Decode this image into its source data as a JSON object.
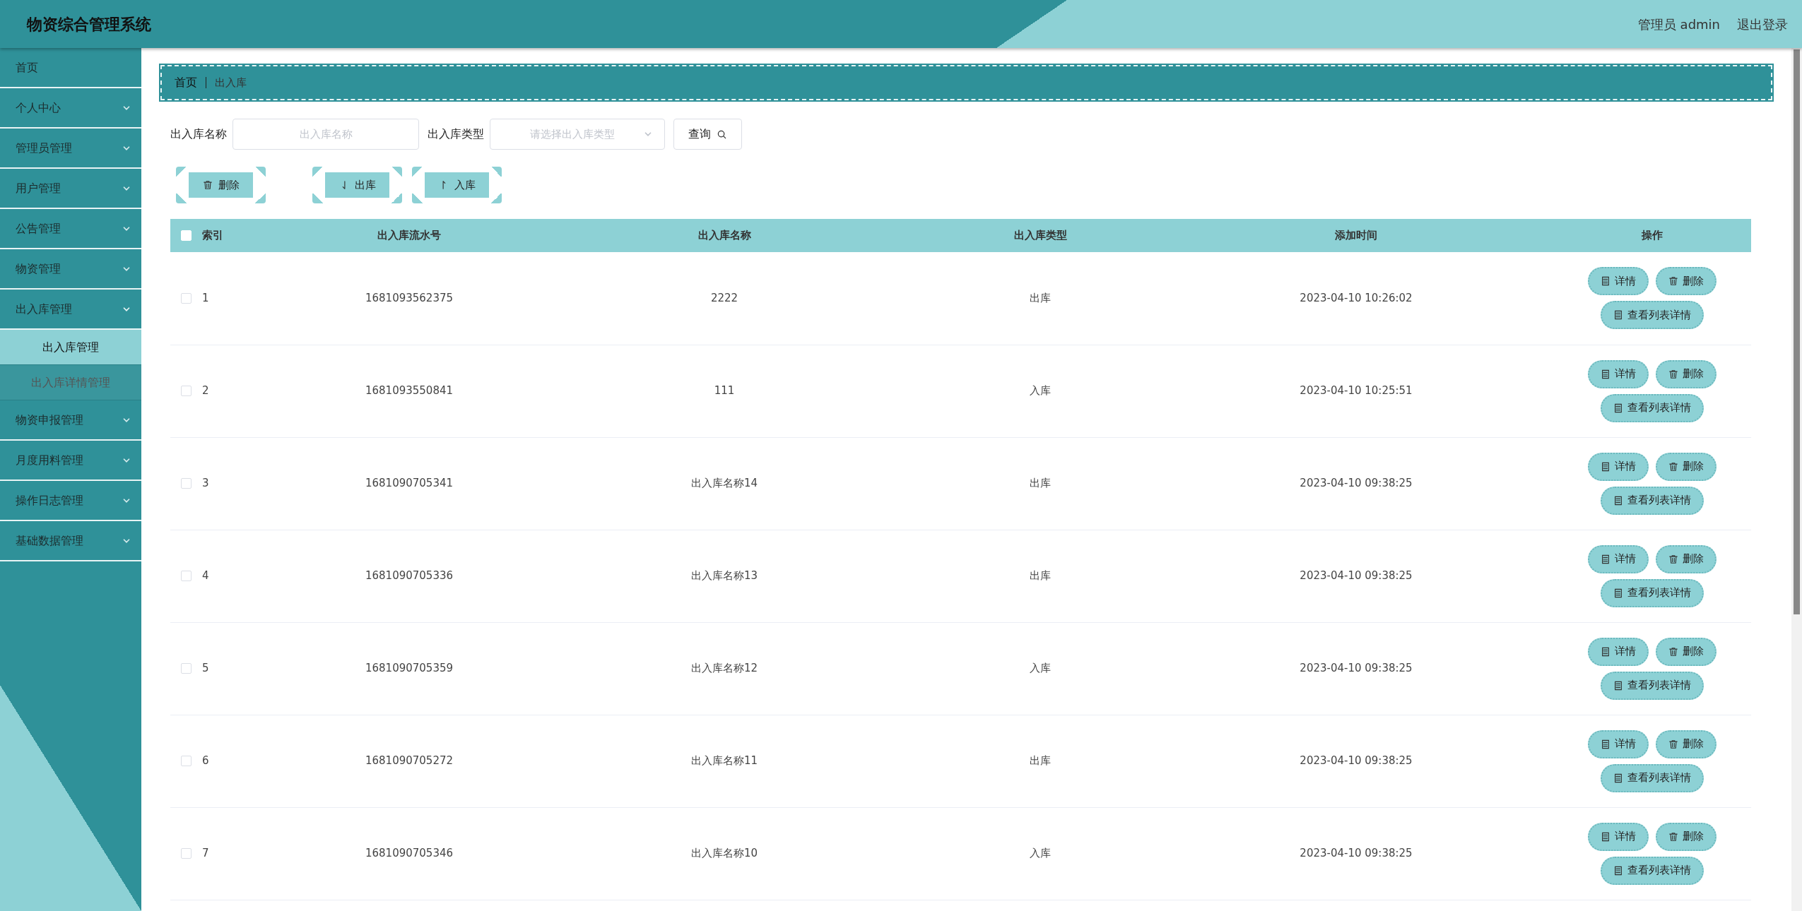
{
  "app": {
    "title": "物资综合管理系统",
    "user": "管理员 admin",
    "logout": "退出登录"
  },
  "sidebar": {
    "items": [
      {
        "label": "首页",
        "kind": "link"
      },
      {
        "label": "个人中心",
        "kind": "menu",
        "expanded": false
      },
      {
        "label": "管理员管理",
        "kind": "menu",
        "expanded": false
      },
      {
        "label": "用户管理",
        "kind": "menu",
        "expanded": false
      },
      {
        "label": "公告管理",
        "kind": "menu",
        "expanded": false
      },
      {
        "label": "物资管理",
        "kind": "menu",
        "expanded": false
      },
      {
        "label": "出入库管理",
        "kind": "menu",
        "expanded": true,
        "children": [
          {
            "label": "出入库管理",
            "selected": true
          },
          {
            "label": "出入库详情管理",
            "selected": false
          }
        ]
      },
      {
        "label": "物资申报管理",
        "kind": "menu",
        "expanded": false
      },
      {
        "label": "月度用料管理",
        "kind": "menu",
        "expanded": false
      },
      {
        "label": "操作日志管理",
        "kind": "menu",
        "expanded": false
      },
      {
        "label": "基础数据管理",
        "kind": "menu",
        "expanded": false
      }
    ]
  },
  "breadcrumb": [
    "首页",
    "出入库"
  ],
  "search": {
    "fields": [
      {
        "label": "出入库名称",
        "placeholder": "出入库名称",
        "kind": "input"
      },
      {
        "label": "出入库类型",
        "placeholder": "请选择出入库类型",
        "kind": "select"
      }
    ],
    "button": "查询"
  },
  "toolbar": [
    {
      "label": "删除",
      "kind": "delete"
    },
    {
      "label": "出库",
      "kind": "out"
    },
    {
      "label": "入库",
      "kind": "in"
    }
  ],
  "table": {
    "select_all": {
      "checked": false
    },
    "columns": [
      "索引",
      "出入库流水号",
      "出入库名称",
      "出入库类型",
      "添加时间",
      "操作"
    ],
    "rows": [
      {
        "checked": false,
        "cells": [
          "1",
          "1681093562375",
          "2222",
          "出库",
          "2023-04-10 10:26:02"
        ],
        "actions": [
          {
            "label": "详情",
            "kind": "doc"
          },
          {
            "label": "删除",
            "kind": "delete"
          },
          {
            "label": "查看列表详情",
            "kind": "doc"
          }
        ]
      },
      {
        "checked": false,
        "cells": [
          "2",
          "1681093550841",
          "111",
          "入库",
          "2023-04-10 10:25:51"
        ],
        "actions": [
          {
            "label": "详情",
            "kind": "doc"
          },
          {
            "label": "删除",
            "kind": "delete"
          },
          {
            "label": "查看列表详情",
            "kind": "doc"
          }
        ]
      },
      {
        "checked": false,
        "cells": [
          "3",
          "1681090705341",
          "出入库名称14",
          "出库",
          "2023-04-10 09:38:25"
        ],
        "actions": [
          {
            "label": "详情",
            "kind": "doc"
          },
          {
            "label": "删除",
            "kind": "delete"
          },
          {
            "label": "查看列表详情",
            "kind": "doc"
          }
        ]
      },
      {
        "checked": false,
        "cells": [
          "4",
          "1681090705336",
          "出入库名称13",
          "出库",
          "2023-04-10 09:38:25"
        ],
        "actions": [
          {
            "label": "详情",
            "kind": "doc"
          },
          {
            "label": "删除",
            "kind": "delete"
          },
          {
            "label": "查看列表详情",
            "kind": "doc"
          }
        ]
      },
      {
        "checked": false,
        "cells": [
          "5",
          "1681090705359",
          "出入库名称12",
          "入库",
          "2023-04-10 09:38:25"
        ],
        "actions": [
          {
            "label": "详情",
            "kind": "doc"
          },
          {
            "label": "删除",
            "kind": "delete"
          },
          {
            "label": "查看列表详情",
            "kind": "doc"
          }
        ]
      },
      {
        "checked": false,
        "cells": [
          "6",
          "1681090705272",
          "出入库名称11",
          "出库",
          "2023-04-10 09:38:25"
        ],
        "actions": [
          {
            "label": "详情",
            "kind": "doc"
          },
          {
            "label": "删除",
            "kind": "delete"
          },
          {
            "label": "查看列表详情",
            "kind": "doc"
          }
        ]
      },
      {
        "checked": false,
        "cells": [
          "7",
          "1681090705346",
          "出入库名称10",
          "入库",
          "2023-04-10 09:38:25"
        ],
        "actions": [
          {
            "label": "详情",
            "kind": "doc"
          },
          {
            "label": "删除",
            "kind": "delete"
          },
          {
            "label": "查看列表详情",
            "kind": "doc"
          }
        ]
      }
    ]
  }
}
